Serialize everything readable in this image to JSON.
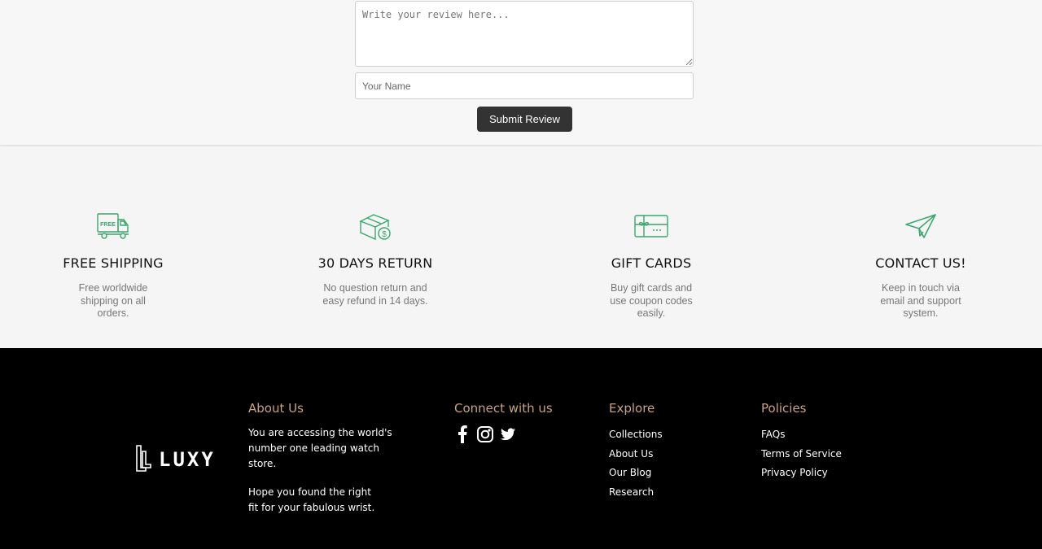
{
  "review_form": {
    "review_placeholder": "Write your review here...",
    "name_placeholder": "Your Name",
    "submit_label": "Submit Review"
  },
  "features": [
    {
      "icon": "free-shipping-truck-icon",
      "icon_text": "FREE",
      "title": "FREE SHIPPING",
      "description": "Free worldwide shipping on all orders."
    },
    {
      "icon": "box-return-icon",
      "title": "30 DAYS RETURN",
      "description": "No question return and easy refund in 14 days."
    },
    {
      "icon": "gift-card-icon",
      "title": "GIFT CARDS",
      "description": "Buy gift cards and use coupon codes easily."
    },
    {
      "icon": "paper-plane-icon",
      "title": "CONTACT US!",
      "description": "Keep in touch via email and support system."
    }
  ],
  "footer": {
    "logo_text": "LUXY",
    "about": {
      "heading": "About Us",
      "paragraph1": "You are accessing the world's number one leading watch store.",
      "paragraph2": "Hope you found the right fit for your fabulous wrist."
    },
    "connect": {
      "heading": "Connect with us",
      "icons": [
        "facebook-icon",
        "instagram-icon",
        "twitter-icon"
      ]
    },
    "explore": {
      "heading": "Explore",
      "links": [
        "Collections",
        "About Us",
        "Our Blog",
        "Research"
      ]
    },
    "policies": {
      "heading": "Policies",
      "links": [
        "FAQs",
        "Terms of Service",
        "Privacy Policy"
      ]
    }
  },
  "colors": {
    "accent_green": "#3aa76d",
    "footer_heading": "#c9a27e",
    "button_dark": "#333333"
  }
}
